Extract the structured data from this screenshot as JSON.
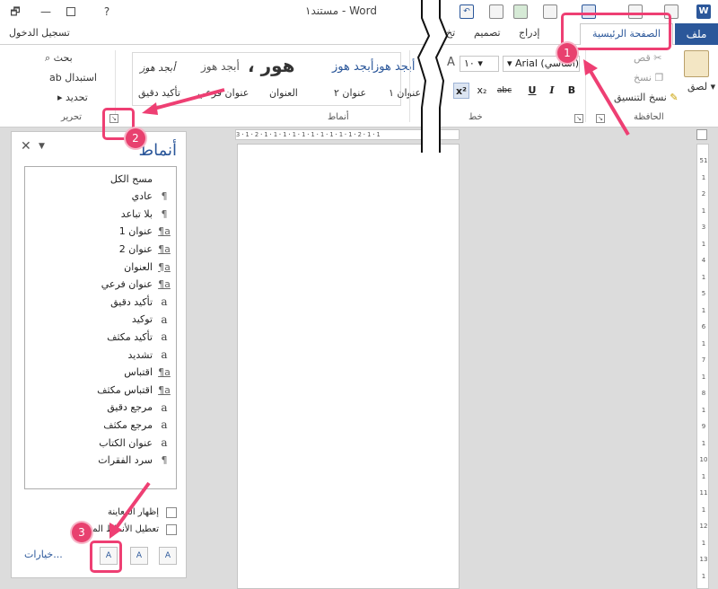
{
  "window": {
    "title": "مستند١ - Word",
    "help": "?",
    "restore": "🗗",
    "minimize": "—"
  },
  "tabs": {
    "file": "ملف",
    "home": "الصفحة الرئيسية",
    "insert": "إدراج",
    "design": "تصميم",
    "partial": "تخ",
    "sign_in": "تسجيل الدخول"
  },
  "clipboard": {
    "paste": "لصق",
    "cut": "قص",
    "copy": "نسخ",
    "format_painter": "نسخ التنسيق",
    "label": "الحافظة"
  },
  "font": {
    "name": "Arial (أساسي)",
    "size": "١٠",
    "bold": "B",
    "italic": "I",
    "underline": "U",
    "strikethrough": "abc",
    "subscript": "x₂",
    "superscript": "x²",
    "label": "خط",
    "grow_font": "A"
  },
  "styles_gallery": {
    "row1": [
      "أبجد هوز",
      "أبجد هوز",
      "أبجد هوز",
      "أبجد هوز",
      "، هور",
      "أبجد هوز",
      "أبجد هوز"
    ],
    "row2": [
      "عنوان ١",
      "عنوان ٢",
      "العنوان",
      "عنوان فرعي",
      "تأكيد دقيق"
    ],
    "label": "أنماط"
  },
  "editing": {
    "find": "بحث",
    "replace": "استبدال",
    "select": "تحديد",
    "label": "تحرير"
  },
  "ruler": {
    "top": "3·1·2·1·1·1·1·1·1·1·1·1·1·2·1·1",
    "right": [
      "51",
      "1",
      "2",
      "1",
      "3",
      "1",
      "4",
      "1",
      "5",
      "1",
      "6",
      "1",
      "7",
      "1",
      "8",
      "1",
      "9",
      "1",
      "10",
      "1",
      "11",
      "1",
      "12",
      "1",
      "13",
      "1"
    ]
  },
  "styles_pane": {
    "title": "أنماط",
    "close": "✕",
    "items": [
      {
        "name": "مسح الكل",
        "icon": ""
      },
      {
        "name": "عادي",
        "icon": "¶"
      },
      {
        "name": "بلا تباعد",
        "icon": "¶"
      },
      {
        "name": "عنوان 1",
        "icon": "¶a"
      },
      {
        "name": "عنوان 2",
        "icon": "¶a"
      },
      {
        "name": "العنوان",
        "icon": "¶a"
      },
      {
        "name": "عنوان فرعي",
        "icon": "¶a"
      },
      {
        "name": "تأكيد دقيق",
        "icon": "a"
      },
      {
        "name": "توكيد",
        "icon": "a"
      },
      {
        "name": "تأكيد مكثف",
        "icon": "a"
      },
      {
        "name": "تشديد",
        "icon": "a"
      },
      {
        "name": "اقتباس",
        "icon": "¶a"
      },
      {
        "name": "اقتباس مكثف",
        "icon": "¶a"
      },
      {
        "name": "مرجع دقيق",
        "icon": "a"
      },
      {
        "name": "مرجع مكثف",
        "icon": "a"
      },
      {
        "name": "عنوان الكتاب",
        "icon": "a"
      },
      {
        "name": "سرد الفقرات",
        "icon": "¶"
      }
    ],
    "show_preview": "إظهار المعاينة",
    "disable_linked": "تعطيل الأنماط المرتبطة",
    "options": "خيارات...",
    "new_style_btn": "A",
    "inspector_btn": "A",
    "manage_btn": "A"
  },
  "callouts": {
    "one": "1",
    "two": "2",
    "three": "3",
    "color": "#e8416f"
  },
  "colors": {
    "accent": "#2b579a",
    "callout": "#e8416f"
  }
}
